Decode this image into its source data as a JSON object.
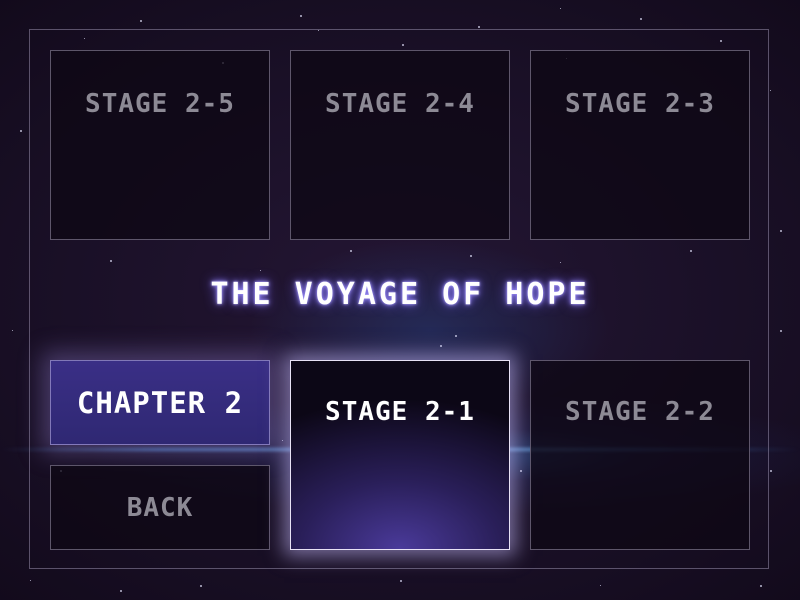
{
  "menu": {
    "title": "THE VOYAGE OF HOPE",
    "chapter_label": "CHAPTER 2",
    "back_label": "BACK",
    "stages": {
      "stage_2_5": "STAGE 2-5",
      "stage_2_4": "STAGE 2-4",
      "stage_2_3": "STAGE 2-3",
      "stage_2_1": "STAGE 2-1",
      "stage_2_2": "STAGE 2-2"
    },
    "selected_stage": "STAGE 2-1"
  },
  "colors": {
    "background": "#1a1027",
    "title_glow": "#9b8cff",
    "chapter_fill": "#3a2f86",
    "selected_fill": "#4a3a9a",
    "inactive_text": "#8d8a95",
    "active_text": "#ffffff"
  }
}
